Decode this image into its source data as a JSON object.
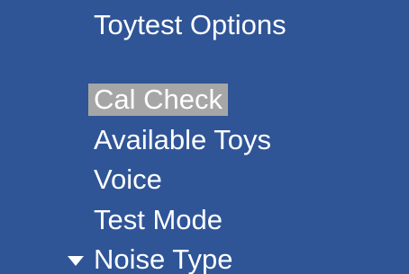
{
  "screen": {
    "title": "Toytest Options",
    "background_color": "#2f5597",
    "highlight_color": "#a6a6a6",
    "text_color": "#ffffff"
  },
  "menu": {
    "items": [
      {
        "label": "Cal Check",
        "selected": true
      },
      {
        "label": "Available Toys",
        "selected": false
      },
      {
        "label": "Voice",
        "selected": false
      },
      {
        "label": "Test Mode",
        "selected": false
      },
      {
        "label": "Noise Type",
        "selected": false,
        "icon": "scroll-down-arrow-icon"
      }
    ]
  }
}
